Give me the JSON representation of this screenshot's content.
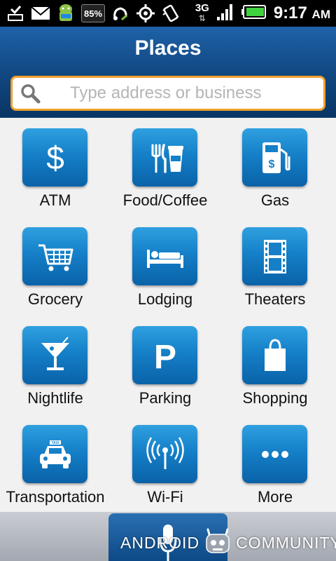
{
  "status_bar": {
    "battery_percent": "85%",
    "network": "3G",
    "time": "9:17",
    "ampm": "AM",
    "icons": [
      "download-complete-icon",
      "mail-icon",
      "android-icon",
      "headset-icon",
      "gps-icon",
      "vibrate-icon",
      "signal-icon",
      "battery-icon"
    ]
  },
  "header": {
    "title": "Places",
    "search_placeholder": "Type address or business"
  },
  "categories": [
    {
      "label": "ATM",
      "icon": "dollar-icon"
    },
    {
      "label": "Food/Coffee",
      "icon": "food-coffee-icon"
    },
    {
      "label": "Gas",
      "icon": "gas-pump-icon"
    },
    {
      "label": "Grocery",
      "icon": "shopping-cart-icon"
    },
    {
      "label": "Lodging",
      "icon": "bed-icon"
    },
    {
      "label": "Theaters",
      "icon": "film-icon"
    },
    {
      "label": "Nightlife",
      "icon": "cocktail-icon"
    },
    {
      "label": "Parking",
      "icon": "parking-icon"
    },
    {
      "label": "Shopping",
      "icon": "shopping-bag-icon"
    },
    {
      "label": "Transportation",
      "icon": "taxi-icon"
    },
    {
      "label": "Wi-Fi",
      "icon": "wifi-icon"
    },
    {
      "label": "More",
      "icon": "more-dots-icon"
    }
  ],
  "watermark": {
    "left": "ANDROID",
    "right": "COMMUNITY"
  },
  "colors": {
    "header_blue": "#10467f",
    "tile_blue": "#1580c8",
    "search_border": "#f0a02c",
    "grid_background": "#f2f1f1"
  }
}
